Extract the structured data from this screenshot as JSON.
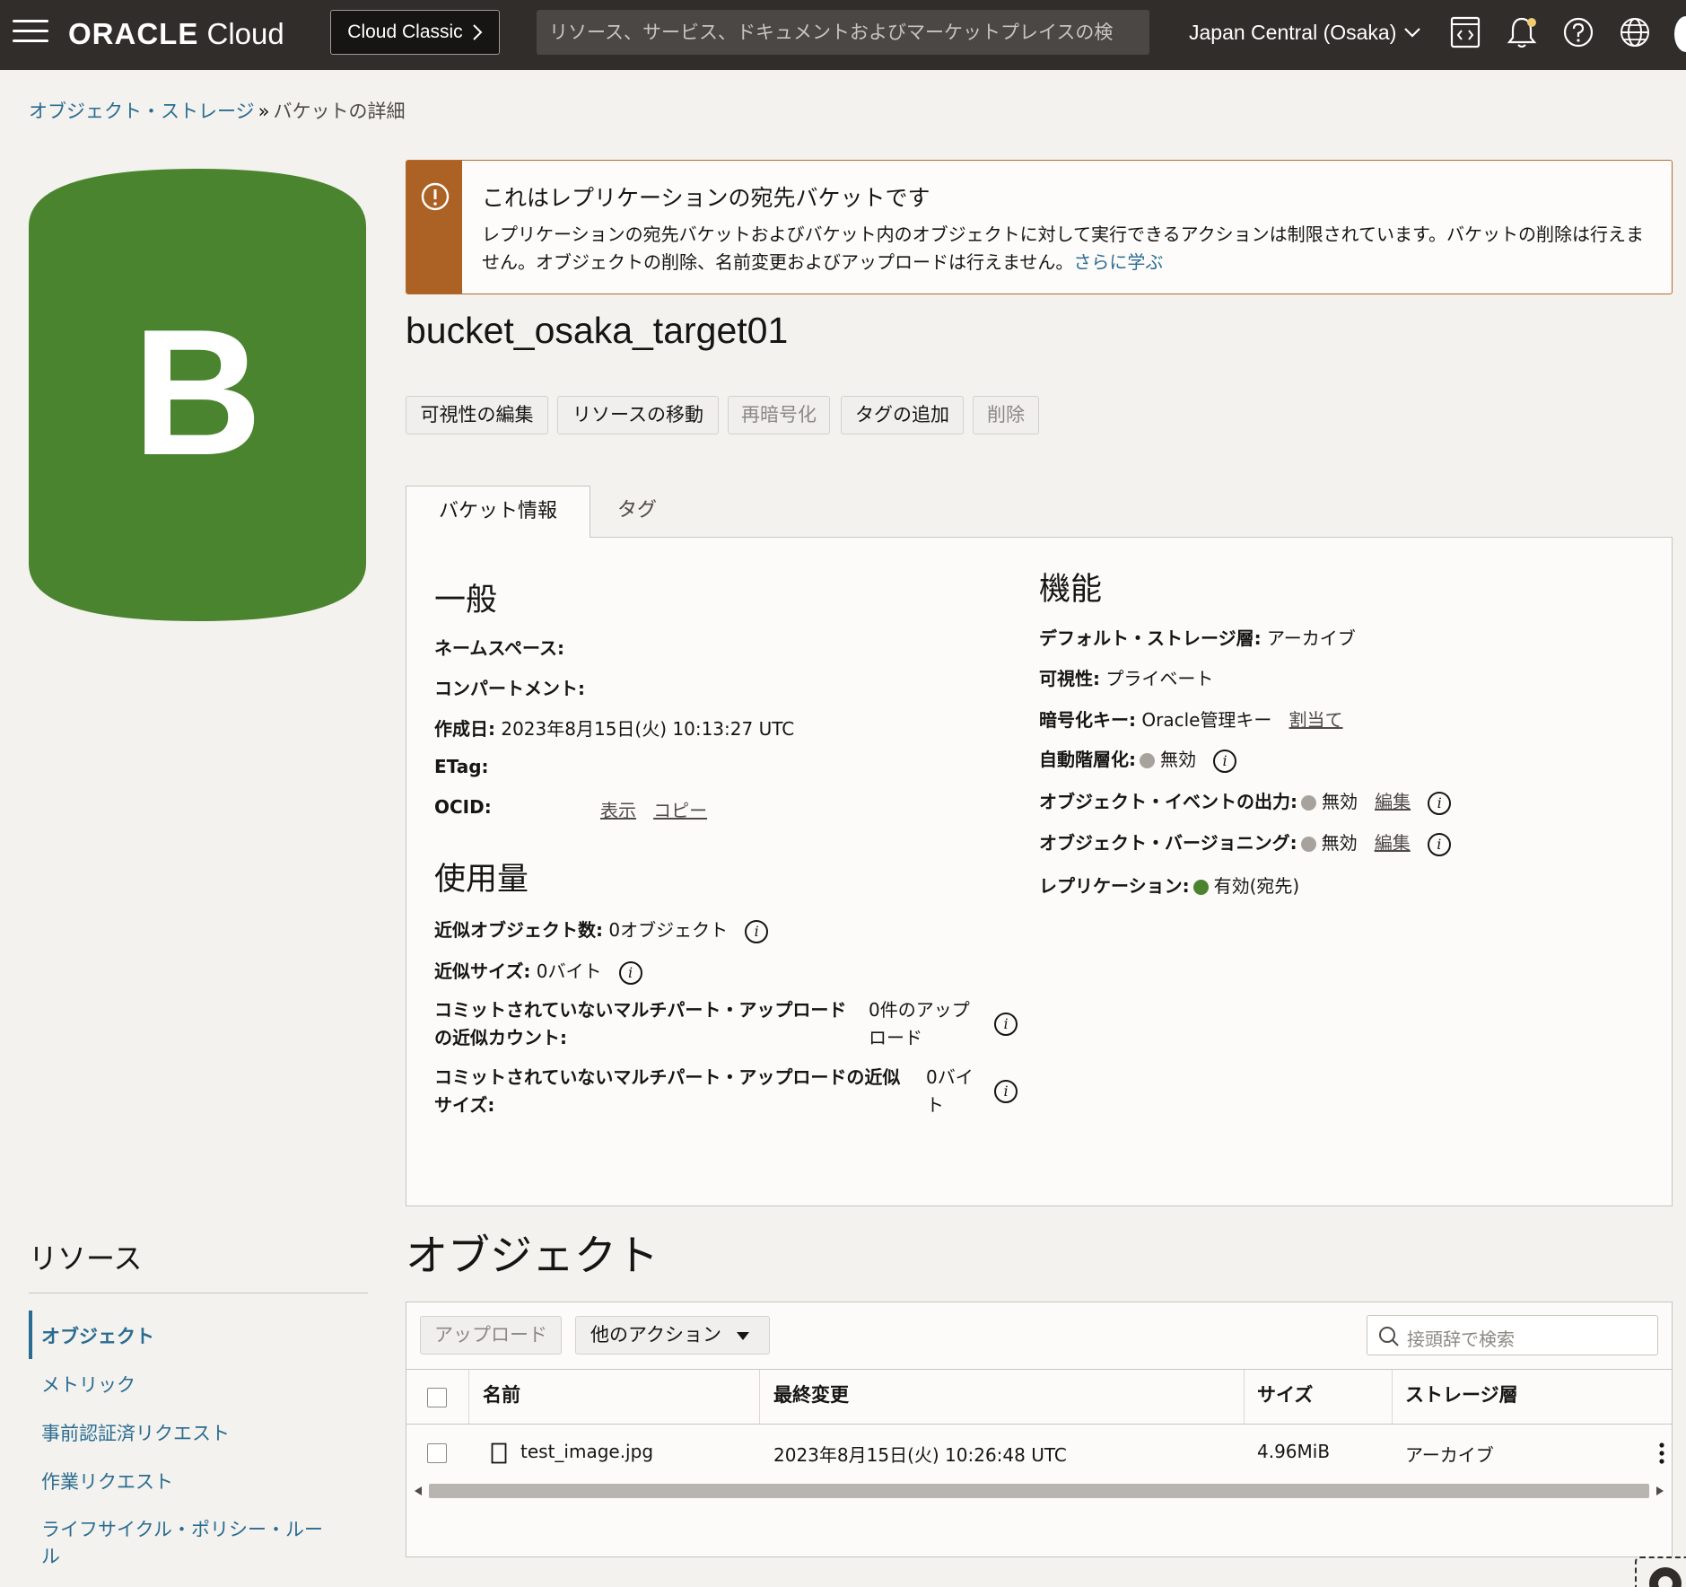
{
  "header": {
    "brand_bold": "ORACLE",
    "brand_light": " Cloud",
    "classic_button": "Cloud Classic",
    "search_placeholder": "リソース、サービス、ドキュメントおよびマーケットプレイスの検",
    "region": "Japan Central (Osaka)"
  },
  "breadcrumb": {
    "parent": "オブジェクト・ストレージ",
    "separator": "»",
    "current": "バケットの詳細"
  },
  "bucket_letter": "B",
  "colors": {
    "bucket": "#4a842e",
    "banner_bar": "#ac6224",
    "link": "#2a6c91",
    "header": "#312d2a"
  },
  "banner": {
    "title": "これはレプリケーションの宛先バケットです",
    "text": "レプリケーションの宛先バケットおよびバケット内のオブジェクトに対して実行できるアクションは制限されています。バケットの削除は行えません。オブジェクトの削除、名前変更およびアップロードは行えません。",
    "link": "さらに学ぶ"
  },
  "title": "bucket_osaka_target01",
  "actions": {
    "edit_visibility": "可視性の編集",
    "move_resource": "リソースの移動",
    "reencrypt": "再暗号化",
    "add_tags": "タグの追加",
    "delete": "削除"
  },
  "tabs": {
    "bucket_info": "バケット情報",
    "tags": "タグ"
  },
  "general": {
    "heading": "一般",
    "namespace_label": "ネームスペース:",
    "compartment_label": "コンパートメント:",
    "created_label": "作成日:",
    "created_value": "2023年8月15日(火) 10:13:27 UTC",
    "etag_label": "ETag:",
    "ocid_label": "OCID:",
    "ocid_show": "表示",
    "ocid_copy": "コピー"
  },
  "usage": {
    "heading": "使用量",
    "obj_count_label": "近似オブジェクト数:",
    "obj_count_value": "0オブジェクト",
    "size_label": "近似サイズ:",
    "size_value": "0バイト",
    "multipart_count_label": "コミットされていないマルチパート・アップロードの近似カウント:",
    "multipart_count_value": "0件のアップロード",
    "multipart_size_label": "コミットされていないマルチパート・アップロードの近似サイズ:",
    "multipart_size_value": "0バイト"
  },
  "features": {
    "heading": "機能",
    "tier_label": "デフォルト・ストレージ層:",
    "tier_value": "アーカイブ",
    "visibility_label": "可視性:",
    "visibility_value": "プライベート",
    "key_label": "暗号化キー:",
    "key_value": "Oracle管理キー",
    "key_assign": "割当て",
    "auto_tier_label": "自動階層化:",
    "auto_tier_value": "無効",
    "events_label": "オブジェクト・イベントの出力:",
    "events_value": "無効",
    "events_edit": "編集",
    "versioning_label": "オブジェクト・バージョニング:",
    "versioning_value": "無効",
    "versioning_edit": "編集",
    "replication_label": "レプリケーション:",
    "replication_value": "有効(宛先)"
  },
  "resources": {
    "title": "リソース",
    "items": [
      "オブジェクト",
      "メトリック",
      "事前認証済リクエスト",
      "作業リクエスト",
      "ライフサイクル・ポリシー・ルール"
    ]
  },
  "objects": {
    "title": "オブジェクト",
    "upload": "アップロード",
    "other_actions": "他のアクション",
    "search_placeholder": "接頭辞で検索",
    "columns": [
      "名前",
      "最終変更",
      "サイズ",
      "ストレージ層"
    ],
    "rows": [
      {
        "name": "test_image.jpg",
        "modified": "2023年8月15日(火) 10:26:48 UTC",
        "size": "4.96MiB",
        "tier": "アーカイブ"
      }
    ]
  }
}
